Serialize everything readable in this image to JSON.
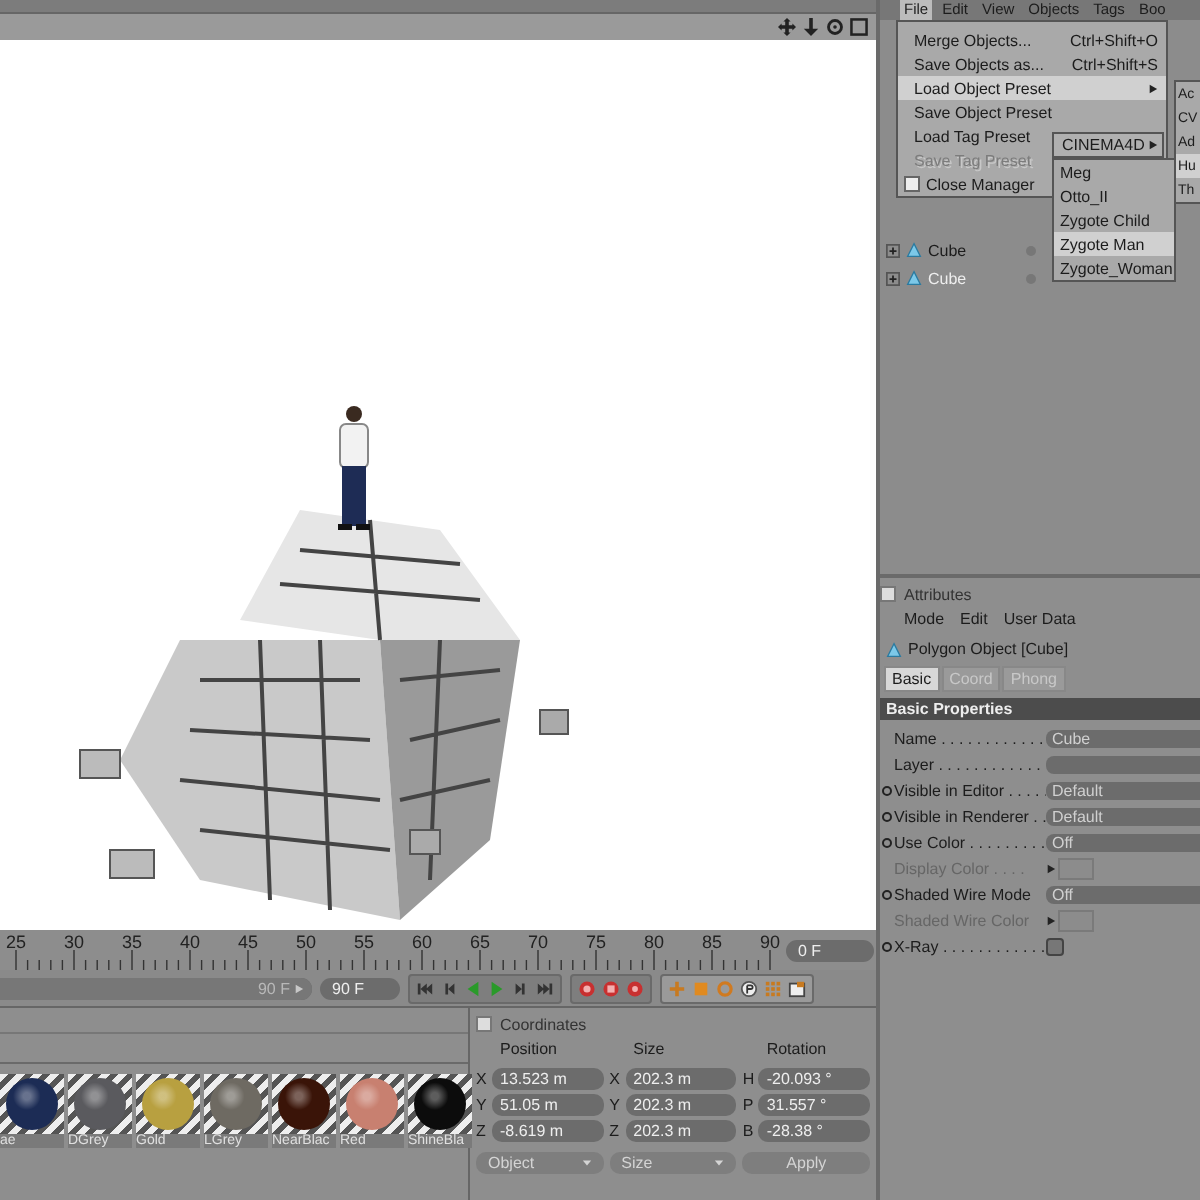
{
  "timeline": {
    "ticks": [
      "25",
      "30",
      "35",
      "40",
      "45",
      "50",
      "55",
      "60",
      "65",
      "70",
      "75",
      "80",
      "85",
      "90"
    ],
    "current_frame": "0 F"
  },
  "transport": {
    "range": {
      "label": "90 F",
      "level": 1
    },
    "end_frame": "90 F"
  },
  "materials": [
    {
      "name": "ae",
      "color": "#1c2c55"
    },
    {
      "name": "DGrey",
      "color": "#5a5a5e"
    },
    {
      "name": "Gold",
      "color": "#b8a040"
    },
    {
      "name": "LGrey",
      "color": "#6e6a62"
    },
    {
      "name": "NearBlac",
      "color": "#3a1408"
    },
    {
      "name": "Red",
      "color": "#c88070"
    },
    {
      "name": "ShineBla",
      "color": "#0c0c0c"
    }
  ],
  "coordinates": {
    "title": "Coordinates",
    "checked": false,
    "columns": [
      "Position",
      "Size",
      "Rotation"
    ],
    "rows": [
      [
        {
          "axis": "X",
          "value": "13.523 m"
        },
        {
          "axis": "X",
          "value": "202.3 m"
        },
        {
          "axis": "H",
          "value": "-20.093 °"
        }
      ],
      [
        {
          "axis": "Y",
          "value": "51.05 m"
        },
        {
          "axis": "Y",
          "value": "202.3 m"
        },
        {
          "axis": "P",
          "value": "31.557 °"
        }
      ],
      [
        {
          "axis": "Z",
          "value": "-8.619 m"
        },
        {
          "axis": "Z",
          "value": "202.3 m"
        },
        {
          "axis": "B",
          "value": "-28.38 °"
        }
      ]
    ],
    "mode_dropdown": "Object",
    "size_dropdown": "Size",
    "apply_button": "Apply"
  },
  "object_manager": {
    "menubar": [
      {
        "label": "File",
        "selected": true
      },
      {
        "label": "Edit",
        "selected": false
      },
      {
        "label": "View",
        "selected": false
      },
      {
        "label": "Objects",
        "selected": false
      },
      {
        "label": "Tags",
        "selected": false
      },
      {
        "label": "Boo",
        "selected": false
      }
    ],
    "objects": [
      {
        "name": "Cube",
        "selected": false
      },
      {
        "name": "Cube",
        "selected": true
      }
    ],
    "file_menu": [
      {
        "kind": "item",
        "label": "Merge Objects...",
        "shortcut": "Ctrl+Shift+O",
        "selected": false,
        "disabled": false
      },
      {
        "kind": "item",
        "label": "Save Objects as...",
        "shortcut": "Ctrl+Shift+S",
        "selected": false,
        "disabled": false
      },
      {
        "kind": "submenu",
        "label": "Load Object Preset",
        "selected": true,
        "disabled": false
      },
      {
        "kind": "item",
        "label": "Save Object Preset",
        "selected": false,
        "disabled": false
      },
      {
        "kind": "item",
        "label": "Load Tag Preset",
        "selected": false,
        "disabled": false
      },
      {
        "kind": "item",
        "label": "Save Tag Preset",
        "selected": false,
        "disabled": true
      },
      {
        "kind": "check",
        "label": "Close Manager",
        "selected": false,
        "disabled": false
      }
    ],
    "preset_menu": [
      {
        "label": "Ac",
        "selected": false
      },
      {
        "label": "CV",
        "selected": false
      },
      {
        "label": "Ad",
        "selected": false
      },
      {
        "label": "Hu",
        "selected": true
      },
      {
        "label": "Th",
        "selected": false
      }
    ],
    "cinema_menu": {
      "label": "CINEMA4D"
    },
    "figure_menu": [
      {
        "label": "Meg",
        "selected": false
      },
      {
        "label": "Otto_II",
        "selected": false
      },
      {
        "label": "Zygote Child",
        "selected": false
      },
      {
        "label": "Zygote Man",
        "selected": true
      },
      {
        "label": "Zygote_Woman",
        "selected": false
      }
    ]
  },
  "attributes": {
    "title": "Attributes",
    "checked": false,
    "menu": [
      "Mode",
      "Edit",
      "User Data"
    ],
    "object": "Polygon Object [Cube]",
    "tabs": [
      {
        "label": "Basic",
        "selected": true
      },
      {
        "label": "Coord",
        "selected": false
      },
      {
        "label": "Phong",
        "selected": false
      }
    ],
    "section": "Basic Properties",
    "properties": [
      {
        "kind": "text",
        "label": "Name . . . . . . . . . . . .",
        "value": "Cube",
        "animatable": false,
        "disabled": false
      },
      {
        "kind": "text",
        "label": "Layer . . . . . . . . . . . .",
        "animatable": false,
        "disabled": false
      },
      {
        "kind": "dropdown",
        "label": "Visible in Editor . . . . .",
        "value": "Default",
        "animatable": true,
        "disabled": false
      },
      {
        "kind": "dropdown",
        "label": "Visible in Renderer . .",
        "value": "Default",
        "animatable": true,
        "disabled": false
      },
      {
        "kind": "dropdown",
        "label": "Use Color . . . . . . . . .",
        "value": "Off",
        "animatable": true,
        "disabled": false
      },
      {
        "kind": "color",
        "label": "Display Color . . . .",
        "animatable": false,
        "disabled": true
      },
      {
        "kind": "dropdown",
        "label": "Shaded Wire Mode",
        "value": "Off",
        "animatable": true,
        "disabled": false
      },
      {
        "kind": "color",
        "label": "Shaded Wire Color",
        "animatable": false,
        "disabled": true
      },
      {
        "kind": "checkbox",
        "label": "X-Ray . . . . . . . . . . . .",
        "checked": false,
        "animatable": true,
        "disabled": false
      }
    ]
  }
}
